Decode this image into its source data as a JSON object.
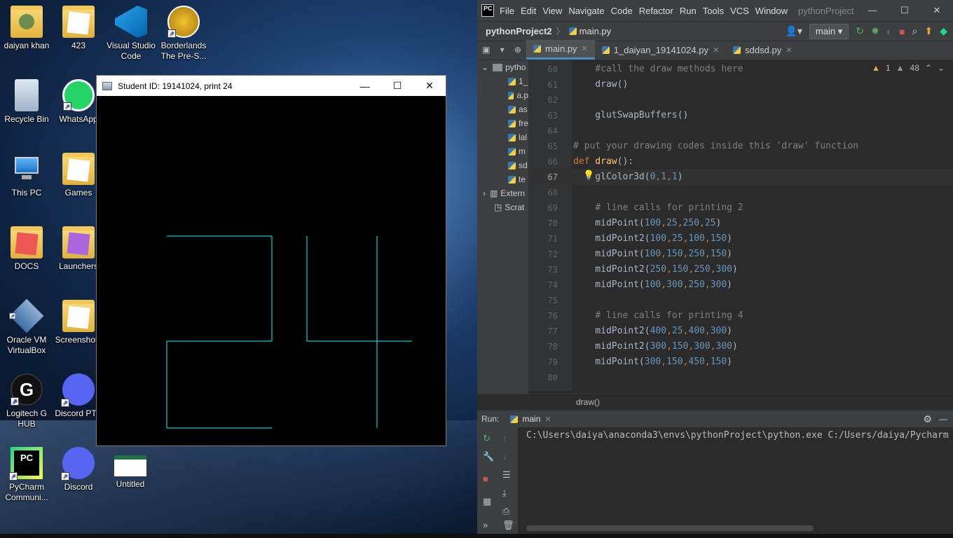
{
  "desktop": {
    "icons": [
      {
        "label": "daiyan khan",
        "icon": "user-folder-icon"
      },
      {
        "label": "423",
        "icon": "folder-icon"
      },
      {
        "label": "Visual Studio Code",
        "icon": "vscode-icon"
      },
      {
        "label": "Borderlands The Pre-S...",
        "icon": "borderlands-icon"
      },
      {
        "label": "Recycle Bin",
        "icon": "recycle-bin-icon"
      },
      {
        "label": "WhatsApp",
        "icon": "whatsapp-icon"
      },
      {
        "label": "This PC",
        "icon": "computer-icon"
      },
      {
        "label": "Games",
        "icon": "folder-icon"
      },
      {
        "label": "DOCS",
        "icon": "folder-icon"
      },
      {
        "label": "Launchers",
        "icon": "folder-icon"
      },
      {
        "label": "Oracle VM VirtualBox",
        "icon": "virtualbox-icon"
      },
      {
        "label": "Screenshots",
        "icon": "folder-icon"
      },
      {
        "label": "Logitech G HUB",
        "icon": "logitech-icon"
      },
      {
        "label": "Discord PTB",
        "icon": "discord-icon"
      },
      {
        "label": "PyCharm Communi...",
        "icon": "pycharm-icon"
      },
      {
        "label": "Discord",
        "icon": "discord-icon"
      },
      {
        "label": "Untitled",
        "icon": "spreadsheet-icon"
      }
    ]
  },
  "student_window": {
    "title": "Student ID: 19141024, print 24",
    "minimize": "—",
    "maximize": "☐",
    "close": "✕"
  },
  "ide": {
    "menu": [
      "File",
      "Edit",
      "View",
      "Navigate",
      "Code",
      "Refactor",
      "Run",
      "Tools",
      "VCS",
      "Window"
    ],
    "project_title": "pythonProject",
    "window_controls": [
      "—",
      "☐",
      "✕"
    ],
    "nav": {
      "project": "pythonProject2",
      "file": "main.py",
      "run_config": "main ▾"
    },
    "tabs": [
      {
        "label": "main.py",
        "active": true
      },
      {
        "label": "1_daiyan_19141024.py",
        "active": false
      },
      {
        "label": "sddsd.py",
        "active": false
      }
    ],
    "project_tree": [
      "pytho",
      "1_",
      "a.p",
      "as",
      "fre",
      "lal",
      "m",
      "sd",
      "te",
      "Extern",
      "Scrat"
    ],
    "inspections": {
      "warnings": "1",
      "weak_warnings": "48"
    },
    "code_lines": [
      {
        "n": "60",
        "parts": [
          {
            "t": "    ",
            "c": ""
          },
          {
            "t": "#call the draw methods here",
            "c": "c-com"
          }
        ]
      },
      {
        "n": "61",
        "parts": [
          {
            "t": "    draw()",
            "c": ""
          }
        ]
      },
      {
        "n": "62",
        "parts": [
          {
            "t": "",
            "c": ""
          }
        ]
      },
      {
        "n": "63",
        "parts": [
          {
            "t": "    glutSwapBuffers()",
            "c": ""
          }
        ]
      },
      {
        "n": "64",
        "parts": [
          {
            "t": "",
            "c": ""
          }
        ]
      },
      {
        "n": "65",
        "parts": [
          {
            "t": "# put your drawing codes inside this 'draw' function",
            "c": "c-com"
          }
        ]
      },
      {
        "n": "66",
        "parts": [
          {
            "t": "def ",
            "c": "c-kw"
          },
          {
            "t": "draw",
            "c": "c-fn"
          },
          {
            "t": "():",
            "c": ""
          }
        ]
      },
      {
        "n": "67",
        "parts": [
          {
            "t": "    glColor3d(",
            "c": ""
          },
          {
            "t": "0",
            "c": "c-num"
          },
          {
            "t": ",",
            "c": "c-kw"
          },
          {
            "t": "1",
            "c": "c-num"
          },
          {
            "t": ",",
            "c": "c-kw"
          },
          {
            "t": "1",
            "c": "c-num"
          },
          {
            "t": ")",
            "c": ""
          }
        ]
      },
      {
        "n": "68",
        "parts": [
          {
            "t": "",
            "c": ""
          }
        ]
      },
      {
        "n": "69",
        "parts": [
          {
            "t": "    ",
            "c": ""
          },
          {
            "t": "# line calls for printing 2",
            "c": "c-com"
          }
        ]
      },
      {
        "n": "70",
        "parts": [
          {
            "t": "    midPoint(",
            "c": ""
          },
          {
            "t": "100",
            "c": "c-num"
          },
          {
            "t": ",",
            "c": "c-kw"
          },
          {
            "t": "25",
            "c": "c-num"
          },
          {
            "t": ",",
            "c": "c-kw"
          },
          {
            "t": "250",
            "c": "c-num"
          },
          {
            "t": ",",
            "c": "c-kw"
          },
          {
            "t": "25",
            "c": "c-num"
          },
          {
            "t": ")",
            "c": ""
          }
        ]
      },
      {
        "n": "71",
        "parts": [
          {
            "t": "    midPoint2(",
            "c": ""
          },
          {
            "t": "100",
            "c": "c-num"
          },
          {
            "t": ",",
            "c": "c-kw"
          },
          {
            "t": "25",
            "c": "c-num"
          },
          {
            "t": ",",
            "c": "c-kw"
          },
          {
            "t": "100",
            "c": "c-num"
          },
          {
            "t": ",",
            "c": "c-kw"
          },
          {
            "t": "150",
            "c": "c-num"
          },
          {
            "t": ")",
            "c": ""
          }
        ]
      },
      {
        "n": "72",
        "parts": [
          {
            "t": "    midPoint(",
            "c": ""
          },
          {
            "t": "100",
            "c": "c-num"
          },
          {
            "t": ",",
            "c": "c-kw"
          },
          {
            "t": "150",
            "c": "c-num"
          },
          {
            "t": ",",
            "c": "c-kw"
          },
          {
            "t": "250",
            "c": "c-num"
          },
          {
            "t": ",",
            "c": "c-kw"
          },
          {
            "t": "150",
            "c": "c-num"
          },
          {
            "t": ")",
            "c": ""
          }
        ]
      },
      {
        "n": "73",
        "parts": [
          {
            "t": "    midPoint2(",
            "c": ""
          },
          {
            "t": "250",
            "c": "c-num"
          },
          {
            "t": ",",
            "c": "c-kw"
          },
          {
            "t": "150",
            "c": "c-num"
          },
          {
            "t": ",",
            "c": "c-kw"
          },
          {
            "t": "250",
            "c": "c-num"
          },
          {
            "t": ",",
            "c": "c-kw"
          },
          {
            "t": "300",
            "c": "c-num"
          },
          {
            "t": ")",
            "c": ""
          }
        ]
      },
      {
        "n": "74",
        "parts": [
          {
            "t": "    midPoint(",
            "c": ""
          },
          {
            "t": "100",
            "c": "c-num"
          },
          {
            "t": ",",
            "c": "c-kw"
          },
          {
            "t": "300",
            "c": "c-num"
          },
          {
            "t": ",",
            "c": "c-kw"
          },
          {
            "t": "250",
            "c": "c-num"
          },
          {
            "t": ",",
            "c": "c-kw"
          },
          {
            "t": "300",
            "c": "c-num"
          },
          {
            "t": ")",
            "c": ""
          }
        ]
      },
      {
        "n": "75",
        "parts": [
          {
            "t": "",
            "c": ""
          }
        ]
      },
      {
        "n": "76",
        "parts": [
          {
            "t": "    ",
            "c": ""
          },
          {
            "t": "# line calls for printing 4",
            "c": "c-com"
          }
        ]
      },
      {
        "n": "77",
        "parts": [
          {
            "t": "    midPoint2(",
            "c": ""
          },
          {
            "t": "400",
            "c": "c-num"
          },
          {
            "t": ",",
            "c": "c-kw"
          },
          {
            "t": "25",
            "c": "c-num"
          },
          {
            "t": ",",
            "c": "c-kw"
          },
          {
            "t": "400",
            "c": "c-num"
          },
          {
            "t": ",",
            "c": "c-kw"
          },
          {
            "t": "300",
            "c": "c-num"
          },
          {
            "t": ")",
            "c": ""
          }
        ]
      },
      {
        "n": "78",
        "parts": [
          {
            "t": "    midPoint2(",
            "c": ""
          },
          {
            "t": "300",
            "c": "c-num"
          },
          {
            "t": ",",
            "c": "c-kw"
          },
          {
            "t": "150",
            "c": "c-num"
          },
          {
            "t": ",",
            "c": "c-kw"
          },
          {
            "t": "300",
            "c": "c-num"
          },
          {
            "t": ",",
            "c": "c-kw"
          },
          {
            "t": "300",
            "c": "c-num"
          },
          {
            "t": ")",
            "c": ""
          }
        ]
      },
      {
        "n": "79",
        "parts": [
          {
            "t": "    midPoint(",
            "c": ""
          },
          {
            "t": "300",
            "c": "c-num"
          },
          {
            "t": ",",
            "c": "c-kw"
          },
          {
            "t": "150",
            "c": "c-num"
          },
          {
            "t": ",",
            "c": "c-kw"
          },
          {
            "t": "450",
            "c": "c-num"
          },
          {
            "t": ",",
            "c": "c-kw"
          },
          {
            "t": "150",
            "c": "c-num"
          },
          {
            "t": ")",
            "c": ""
          }
        ]
      },
      {
        "n": "80",
        "parts": [
          {
            "t": "",
            "c": ""
          }
        ]
      }
    ],
    "breadcrumb": "draw()",
    "run": {
      "label": "Run:",
      "tab": "main",
      "console": "C:\\Users\\daiya\\anaconda3\\envs\\pythonProject\\python.exe C:/Users/daiya/Pycharm"
    }
  },
  "colors": {
    "line_color": "#00ffff",
    "editor_bg": "#2b2b2b",
    "accent": "#4a88c7"
  }
}
